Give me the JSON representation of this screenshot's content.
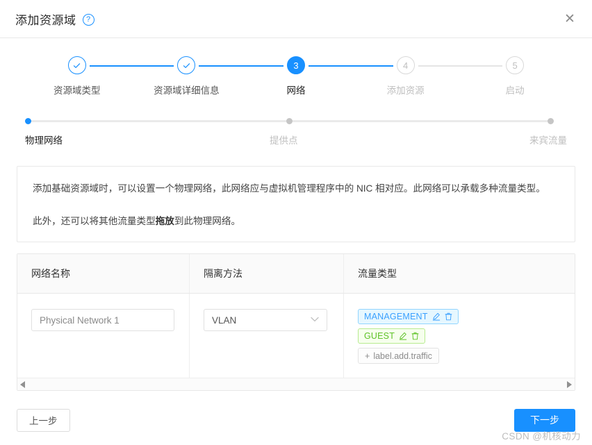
{
  "dialog": {
    "title": "添加资源域",
    "help_icon": "help-circle-icon",
    "close_icon": "close-icon"
  },
  "stepper": {
    "steps": [
      {
        "label": "资源域类型",
        "state": "done",
        "marker": "✓"
      },
      {
        "label": "资源域详细信息",
        "state": "done",
        "marker": "✓"
      },
      {
        "label": "网络",
        "state": "active",
        "marker": "3"
      },
      {
        "label": "添加资源",
        "state": "todo",
        "marker": "4"
      },
      {
        "label": "启动",
        "state": "todo",
        "marker": "5"
      }
    ]
  },
  "substepper": {
    "steps": [
      {
        "label": "物理网络",
        "state": "active"
      },
      {
        "label": "提供点",
        "state": "todo"
      },
      {
        "label": "来宾流量",
        "state": "todo"
      }
    ]
  },
  "info": {
    "paragraph1_a": "添加基础资源域时，可以设置一个物理网络，此网络应与虚拟机管理程序中的 NIC 相对应。此网络可以承载多种流量类型。",
    "paragraph2_a": "此外，还可以将其他流量类型",
    "paragraph2_bold": "拖放",
    "paragraph2_b": "到此物理网络。"
  },
  "table": {
    "headers": [
      "网络名称",
      "隔离方法",
      "流量类型"
    ],
    "row": {
      "network_name": "Physical Network 1",
      "isolation_method": "VLAN",
      "traffic_tags": [
        {
          "label": "MANAGEMENT",
          "color": "#3aa0ff",
          "bg": "#e6f7ff",
          "border": "#91d5ff"
        },
        {
          "label": "GUEST",
          "color": "#5fc227",
          "bg": "#f6ffed",
          "border": "#b7eb8f"
        }
      ],
      "add_traffic_label": "label.add.traffic",
      "add_traffic_plus": "+"
    },
    "scroll_left_icon": "scroll-left-arrow-icon",
    "scroll_right_icon": "scroll-right-arrow-icon"
  },
  "footer": {
    "prev_label": "上一步",
    "next_label": "下一步"
  },
  "watermark": "CSDN @机核动力",
  "colors": {
    "accent": "#1890ff",
    "border": "#e8e8e8",
    "muted": "#bfbfbf"
  }
}
